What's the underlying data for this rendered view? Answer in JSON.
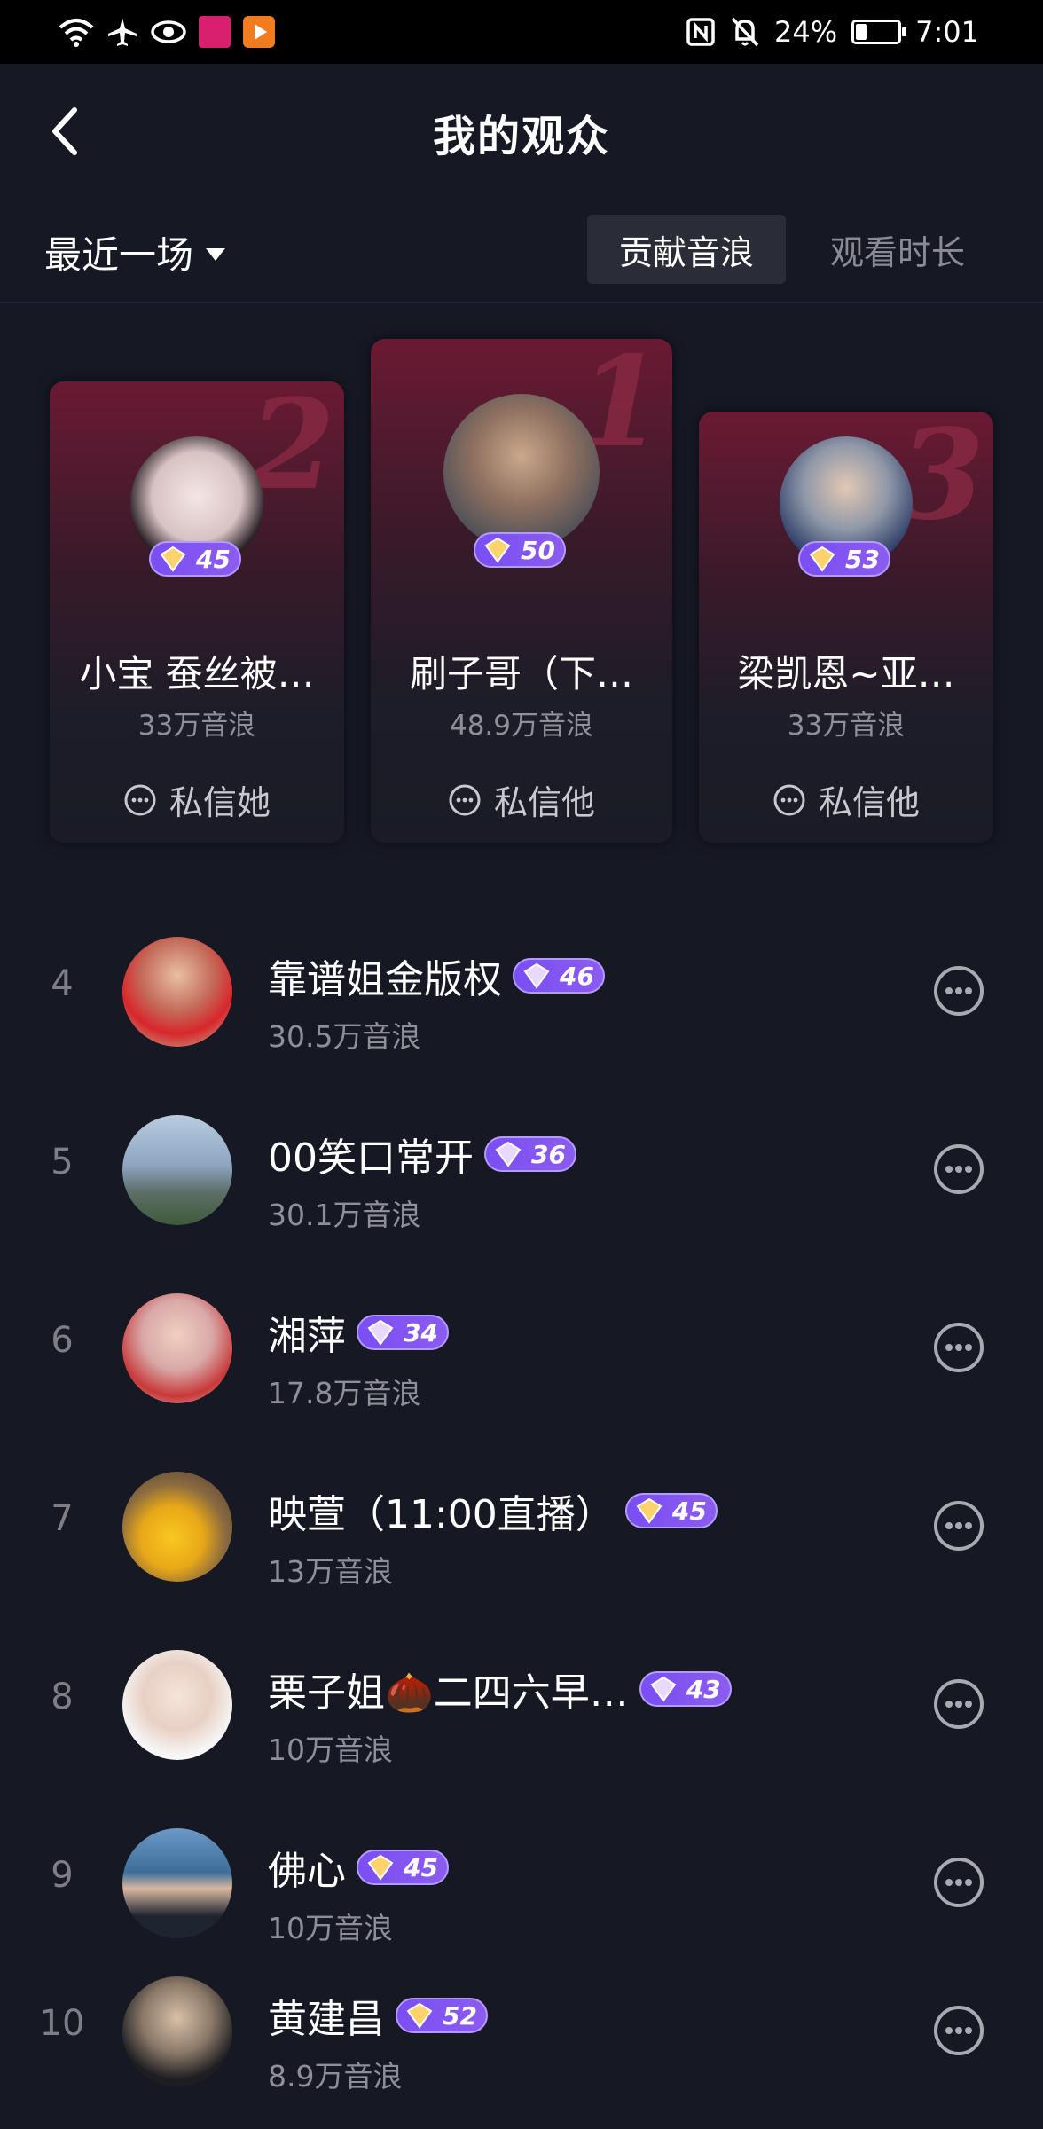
{
  "status_bar": {
    "battery_pct": "24%",
    "time": "7:01",
    "icons": [
      "wifi-icon",
      "airplane-icon",
      "eye-icon",
      "app-icon-pink",
      "app-icon-orange",
      "nfc-icon",
      "mute-bell-icon",
      "battery-icon"
    ]
  },
  "header": {
    "title": "我的观众",
    "back_icon": "chevron-left-icon"
  },
  "filter": {
    "range_label": "最近一场",
    "tab_contribution": "贡献音浪",
    "tab_watch_time": "观看时长",
    "active_tab": "贡献音浪"
  },
  "podium": [
    {
      "rank": "2",
      "name": "小宝 蚕丝被…",
      "level": "45",
      "amount": "33万音浪",
      "dm_label": "私信她"
    },
    {
      "rank": "1",
      "name": "刷子哥（下…",
      "level": "50",
      "amount": "48.9万音浪",
      "dm_label": "私信他"
    },
    {
      "rank": "3",
      "name": "梁凯恩~亚…",
      "level": "53",
      "amount": "33万音浪",
      "dm_label": "私信他"
    }
  ],
  "list": [
    {
      "rank": "4",
      "name": "靠谱姐金版权",
      "level": "46",
      "amount": "30.5万音浪"
    },
    {
      "rank": "5",
      "name": "00笑口常开",
      "level": "36",
      "amount": "30.1万音浪"
    },
    {
      "rank": "6",
      "name": "湘萍",
      "level": "34",
      "amount": "17.8万音浪"
    },
    {
      "rank": "7",
      "name": "映萱（11:00直播）",
      "level": "45",
      "amount": "13万音浪"
    },
    {
      "rank": "8",
      "name": "栗子姐🌰二四六早…",
      "level": "43",
      "amount": "10万音浪"
    },
    {
      "rank": "9",
      "name": "佛心",
      "level": "45",
      "amount": "10万音浪"
    },
    {
      "rank": "10",
      "name": "黄建昌",
      "level": "52",
      "amount": "8.9万音浪"
    }
  ],
  "colors": {
    "background": "#161823",
    "badge_purple": "#7a4ef2",
    "card_red": "#6a1a33",
    "muted_text": "#8e8f97"
  }
}
